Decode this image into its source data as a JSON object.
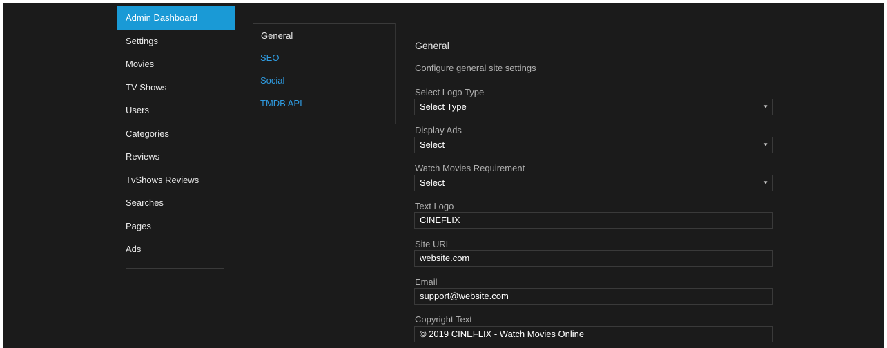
{
  "sidebar": {
    "items": [
      {
        "label": "Admin Dashboard",
        "active": true
      },
      {
        "label": "Settings"
      },
      {
        "label": "Movies"
      },
      {
        "label": "TV Shows"
      },
      {
        "label": "Users"
      },
      {
        "label": "Categories"
      },
      {
        "label": "Reviews"
      },
      {
        "label": "TvShows Reviews"
      },
      {
        "label": "Searches"
      },
      {
        "label": "Pages"
      },
      {
        "label": "Ads"
      }
    ]
  },
  "tabs": [
    {
      "label": "General",
      "active": true
    },
    {
      "label": "SEO"
    },
    {
      "label": "Social"
    },
    {
      "label": "TMDB API"
    }
  ],
  "main": {
    "title": "General",
    "subtitle": "Configure general site settings",
    "fields": [
      {
        "label": "Select Logo Type",
        "value": "Select Type",
        "type": "select"
      },
      {
        "label": "Display Ads",
        "value": "Select",
        "type": "select"
      },
      {
        "label": "Watch Movies Requirement",
        "value": "Select",
        "type": "select"
      },
      {
        "label": "Text Logo",
        "value": "CINEFLIX",
        "type": "text"
      },
      {
        "label": "Site URL",
        "value": "website.com",
        "type": "text"
      },
      {
        "label": "Email",
        "value": "support@website.com",
        "type": "text"
      },
      {
        "label": "Copyright Text",
        "value": "© 2019 CINEFLIX - Watch Movies Online",
        "type": "text"
      }
    ],
    "select_arrow": "▼"
  },
  "colors": {
    "background": "#1b1b1b",
    "accent": "#1a9ad6",
    "link": "#2f9be0",
    "border": "#3a3a3a"
  }
}
